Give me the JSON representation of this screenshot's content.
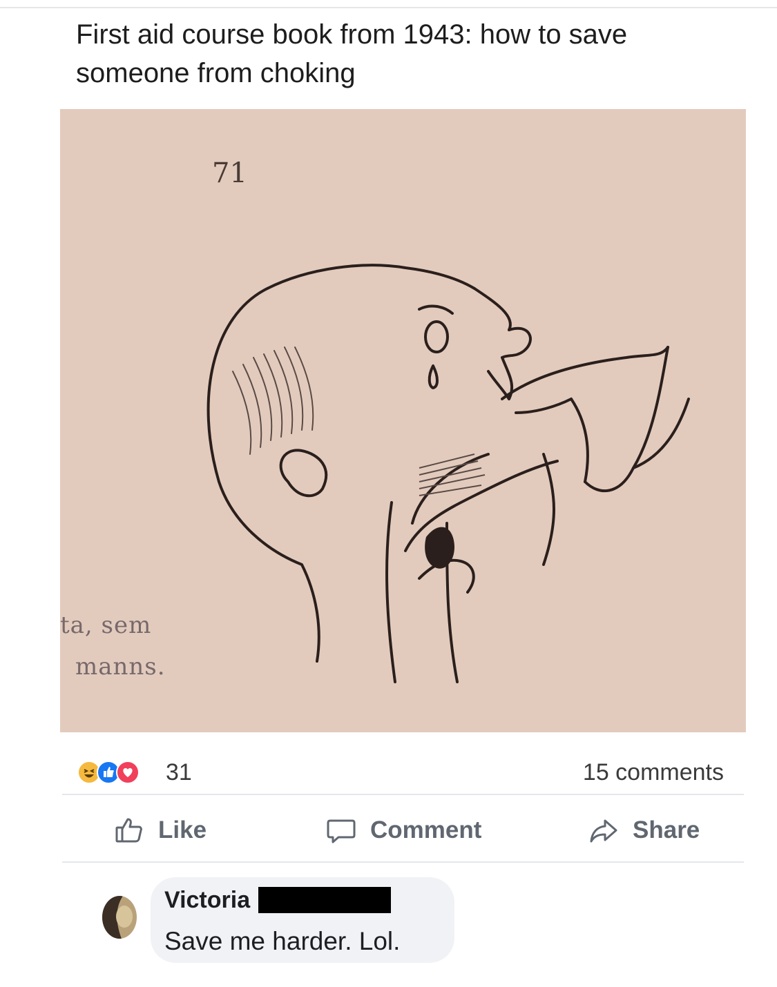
{
  "post": {
    "text": "First aid course book from 1943: how to save someone from choking"
  },
  "photo": {
    "page_number": "71",
    "caption_line_1": "ta, sem",
    "caption_line_2": "manns."
  },
  "reactions": {
    "icons": [
      "haha-reaction-icon",
      "like-reaction-icon",
      "love-reaction-icon"
    ],
    "count": "31",
    "comments_count": "15 comments"
  },
  "actions": {
    "like_label": "Like",
    "comment_label": "Comment",
    "share_label": "Share"
  },
  "comment": {
    "author": "Victoria",
    "text": "Save me harder. Lol."
  },
  "colors": {
    "photo_background": "#e2cbbd",
    "like_blue": "#1877f2",
    "love_red": "#f0405b",
    "haha_yellow": "#f5b93f",
    "action_gray": "#606770",
    "bubble_gray": "#f0f2f5"
  }
}
